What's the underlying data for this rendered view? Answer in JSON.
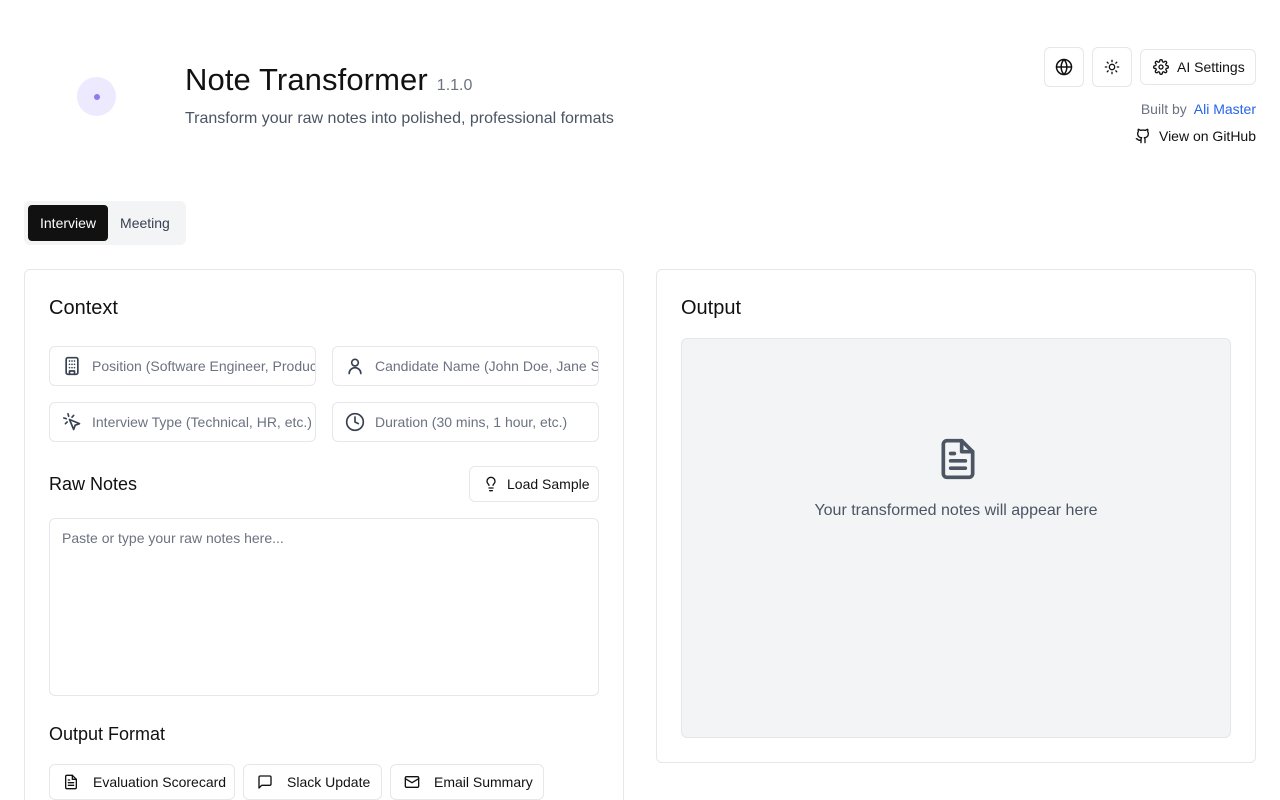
{
  "header": {
    "title": "Note Transformer",
    "version": "1.1.0",
    "subtitle": "Transform your raw notes into polished, professional formats",
    "ai_settings_label": "AI Settings",
    "built_by_label": "Built by",
    "author": "Ali Master",
    "github_label": "View on GitHub"
  },
  "tabs": [
    {
      "label": "Interview",
      "active": true
    },
    {
      "label": "Meeting",
      "active": false
    }
  ],
  "context": {
    "title": "Context",
    "fields": [
      {
        "placeholder": "Position (Software Engineer, Product Manager, etc.)",
        "icon": "building-icon"
      },
      {
        "placeholder": "Candidate Name (John Doe, Jane Smith, etc.)",
        "icon": "user-icon"
      },
      {
        "placeholder": "Interview Type (Technical, HR, etc.)",
        "icon": "pointer-click-icon"
      },
      {
        "placeholder": "Duration (30 mins, 1 hour, etc.)",
        "icon": "clock-icon"
      }
    ],
    "raw_notes_label": "Raw Notes",
    "load_sample_label": "Load Sample",
    "raw_notes_placeholder": "Paste or type your raw notes here...",
    "output_format_label": "Output Format",
    "formats": [
      {
        "label": "Evaluation Scorecard",
        "icon": "document-icon"
      },
      {
        "label": "Slack Update",
        "icon": "message-icon"
      },
      {
        "label": "Email Summary",
        "icon": "mail-icon"
      }
    ]
  },
  "output": {
    "title": "Output",
    "empty_text": "Your transformed notes will appear here"
  },
  "colors": {
    "accent": "#111111",
    "link": "#2563eb",
    "muted": "#6b7280",
    "border": "#e5e7eb",
    "panel": "#f3f4f6"
  }
}
